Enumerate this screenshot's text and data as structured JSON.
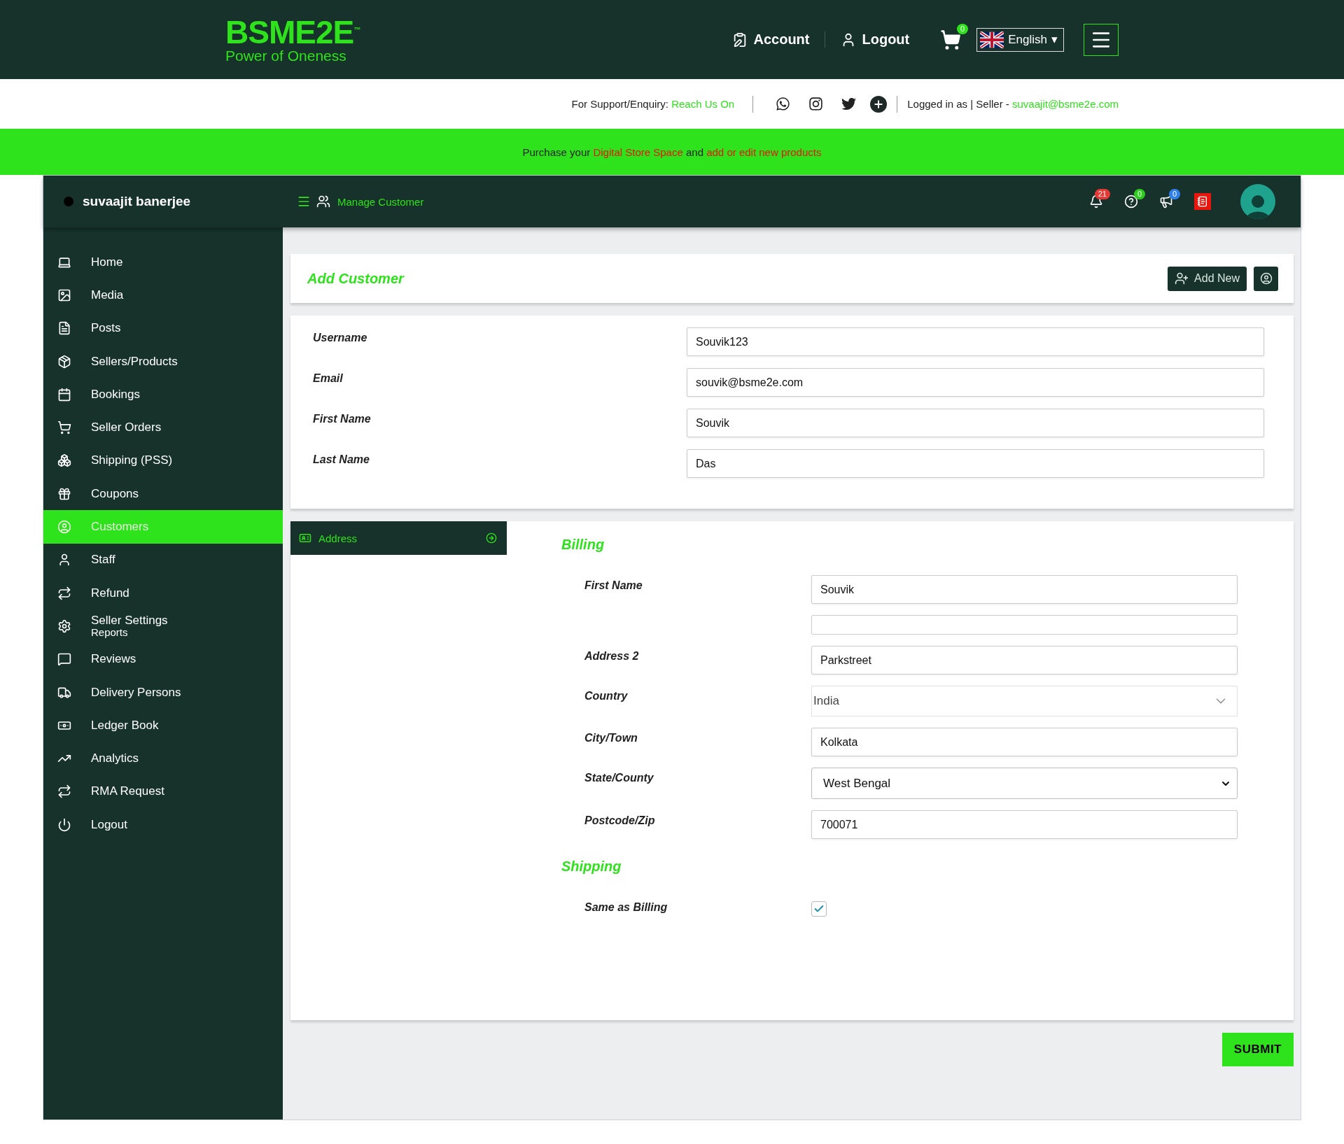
{
  "header": {
    "logo": {
      "name": "BSME2E",
      "trademark": "™",
      "tagline": "Power of Oneness"
    },
    "nav": [
      {
        "kind": "account",
        "label": "Account"
      },
      {
        "kind": "logout",
        "label": "Logout"
      }
    ],
    "cart_count": "0",
    "language": "English",
    "language_caret": "▾"
  },
  "support_bar": {
    "prefix": "For Support/Enquiry:",
    "link": "Reach Us On",
    "logged_in": "Logged in as | Seller -",
    "email": "suvaajit@bsme2e.com"
  },
  "banner": {
    "parts": [
      {
        "text": "Purchase your ",
        "highlight": false
      },
      {
        "text": "Digital Store Space",
        "highlight": true
      },
      {
        "text": " and ",
        "highlight": false
      },
      {
        "text": "add or edit new products",
        "highlight": true
      }
    ]
  },
  "topbar": {
    "user_name": "suvaajit banerjee",
    "breadcrumb": "Manage Customer",
    "notifications": [
      {
        "kind": "bell",
        "count": "21",
        "color": "#e53935"
      },
      {
        "kind": "help",
        "count": "0",
        "color": "#2ecc1f"
      },
      {
        "kind": "megaphone",
        "count": "0",
        "color": "#2f80ed"
      }
    ]
  },
  "sidebar": {
    "items": [
      {
        "label": "Home",
        "selected": false
      },
      {
        "label": "Media",
        "selected": false
      },
      {
        "label": "Posts",
        "selected": false
      },
      {
        "label": "Sellers/Products",
        "selected": false
      },
      {
        "label": "Bookings",
        "selected": false
      },
      {
        "label": "Seller Orders",
        "selected": false
      },
      {
        "label": "Shipping (PSS)",
        "selected": false
      },
      {
        "label": "Coupons",
        "selected": false
      },
      {
        "label": "Customers",
        "selected": true
      },
      {
        "label": "Staff",
        "selected": false
      },
      {
        "label": "Refund",
        "selected": false
      },
      {
        "label": "Seller Settings",
        "overlap_label": "Reports",
        "selected": false
      },
      {
        "label": "Reviews",
        "selected": false
      },
      {
        "label": "Delivery Persons",
        "selected": false
      },
      {
        "label": "Ledger Book",
        "selected": false
      },
      {
        "label": "Analytics",
        "selected": false
      },
      {
        "label": "RMA Request",
        "selected": false
      },
      {
        "label": "Logout",
        "selected": false
      }
    ]
  },
  "page_title": "Add Customer",
  "add_button": "Add New",
  "account_fields": [
    {
      "label": "Username",
      "value": "Souvik123"
    },
    {
      "label": "Email",
      "value": "souvik@bsme2e.com"
    },
    {
      "label": "First Name",
      "value": "Souvik"
    },
    {
      "label": "Last Name",
      "value": "Das"
    }
  ],
  "address_tab": {
    "label": "Address",
    "selected": true
  },
  "billing": {
    "title": "Billing",
    "rows": [
      {
        "kind": "text",
        "label": "First Name",
        "value": "Souvik"
      },
      {
        "kind": "clipped"
      },
      {
        "kind": "text",
        "label": "Address 2",
        "value": "Parkstreet"
      },
      {
        "kind": "combo",
        "label": "Country",
        "value": "India"
      },
      {
        "kind": "text",
        "label": "City/Town",
        "value": "Kolkata"
      },
      {
        "kind": "select",
        "label": "State/County",
        "value": "West Bengal"
      },
      {
        "kind": "text",
        "label": "Postcode/Zip",
        "value": "700071"
      }
    ]
  },
  "shipping": {
    "title": "Shipping",
    "same_as_billing": {
      "label": "Same as Billing",
      "checked": true
    }
  },
  "submit": "SUBMIT"
}
